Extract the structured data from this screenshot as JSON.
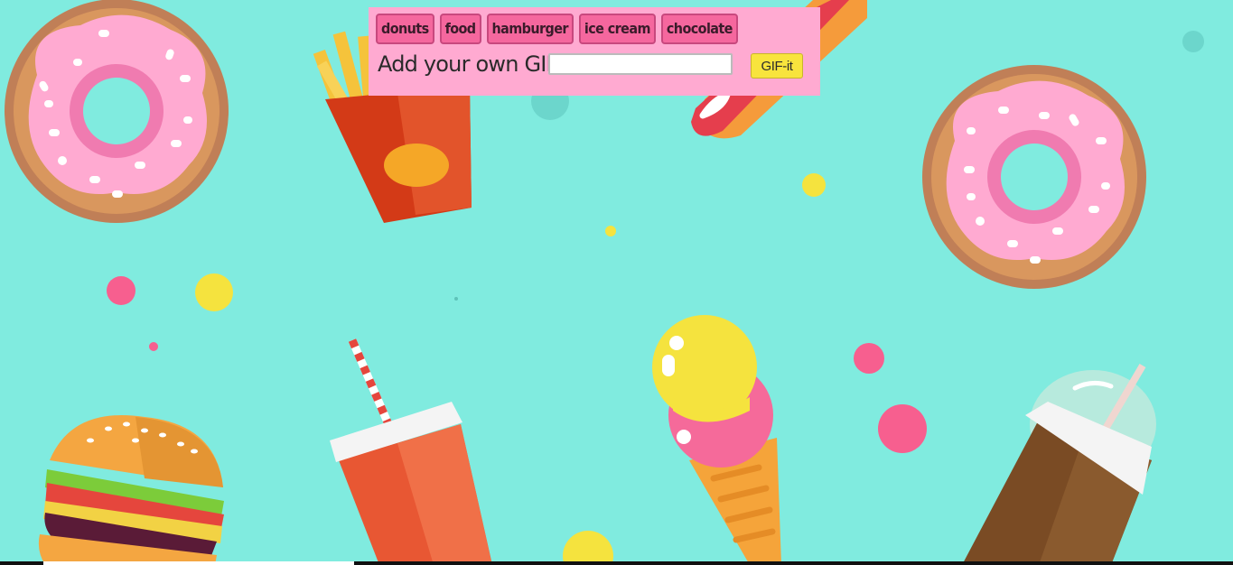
{
  "tags": [
    {
      "label": "donuts"
    },
    {
      "label": "food"
    },
    {
      "label": "hamburger"
    },
    {
      "label": "ice cream"
    },
    {
      "label": "chocolate"
    }
  ],
  "add_gif": {
    "label": "Add your own GIF",
    "input_value": "",
    "button_label": "GIF-it"
  },
  "colors": {
    "background": "#80ebdf",
    "panel": "#ffaad1",
    "tag_button": "#f5679e",
    "gif_button": "#f8e43d"
  },
  "background_icons": [
    "donut-icon",
    "fries-icon",
    "hotdog-icon",
    "donut-icon",
    "hamburger-icon",
    "soda-cup-icon",
    "ice-cream-cone-icon",
    "iced-coffee-icon"
  ]
}
